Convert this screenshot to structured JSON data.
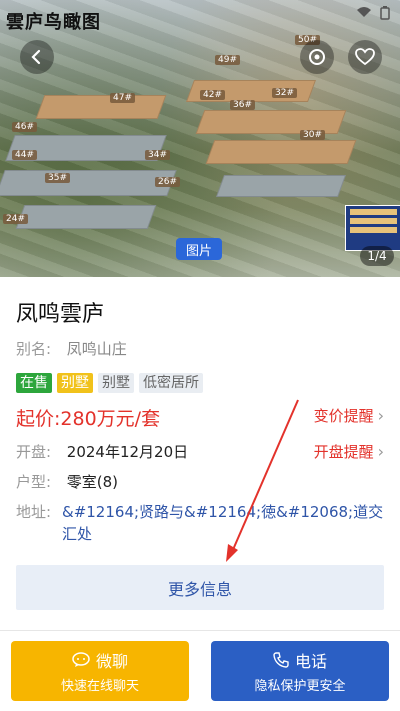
{
  "hero": {
    "title": "雲庐鸟瞰图",
    "picture_label": "图片",
    "page_indicator": "1/4",
    "building_labels": [
      "49#",
      "50#",
      "42#",
      "36#",
      "32#",
      "30#",
      "47#",
      "43#",
      "46#",
      "41#",
      "44#",
      "38#",
      "34#",
      "35#",
      "29#",
      "26#",
      "24#",
      "23#"
    ]
  },
  "project": {
    "name": "凤鸣雲庐",
    "alias_label": "别名:",
    "alias": "凤鸣山庄",
    "tags": [
      "在售",
      "别墅",
      "别墅",
      "低密居所"
    ],
    "price": "起价:280万元/套",
    "price_alert": "变价提醒",
    "open_label": "开盘:",
    "open_date": "2024年12月20日",
    "open_alert": "开盘提醒",
    "type_label": "户型:",
    "type_value": "零室(8)",
    "address_label": "地址:",
    "address_value": "&#12164;贤路与&#12164;徳&#12068;道交汇处"
  },
  "actions": {
    "more_info": "更多信息",
    "chat_main": "微聊",
    "chat_sub": "快速在线聊天",
    "phone_main": "电话",
    "phone_sub": "隐私保护更安全"
  },
  "colors": {
    "accent_blue": "#2b5fc4",
    "price_red": "#e3322b",
    "tag_green": "#2da63c",
    "tag_yellow": "#f1c21b",
    "chat_yellow": "#f7b500"
  }
}
